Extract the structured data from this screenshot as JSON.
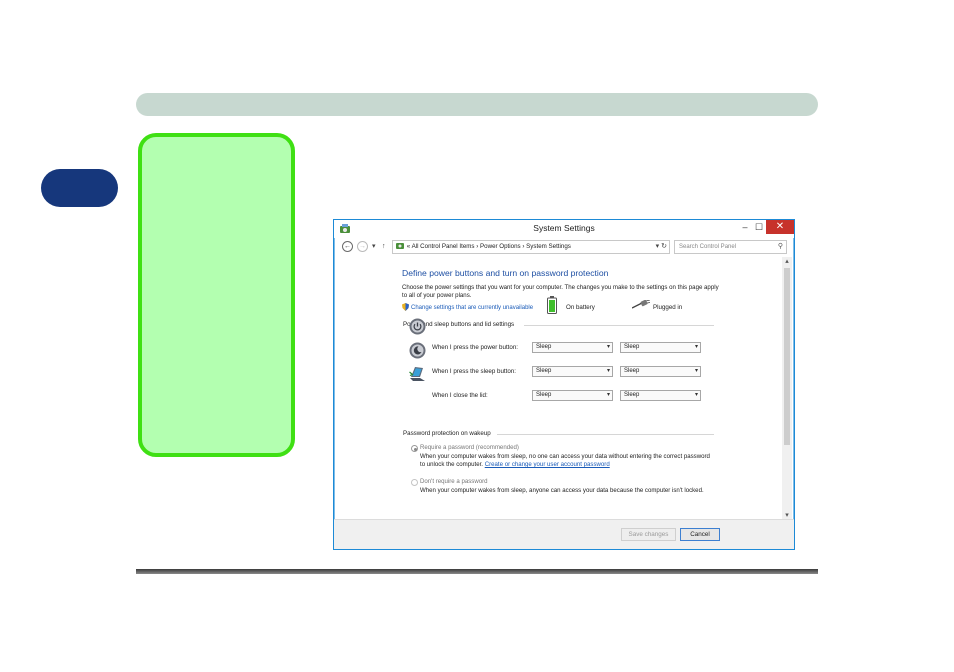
{
  "window": {
    "title": "System Settings",
    "controls": {
      "minimize": "–",
      "maximize": "☐",
      "close": "✕"
    }
  },
  "address_bar": {
    "prefix": "«",
    "breadcrumbs": [
      "All Control Panel Items",
      "Power Options",
      "System Settings"
    ],
    "separator": "›",
    "search_placeholder": "Search Control Panel"
  },
  "page": {
    "heading": "Define power buttons and turn on password protection",
    "description": "Choose the power settings that you want for your computer. The changes you make to the settings on this page apply to all of your power plans.",
    "change_link": "Change settings that are currently unavailable"
  },
  "power_section": {
    "label": "Power and sleep buttons and lid settings",
    "columns": {
      "battery": "On battery",
      "plugged": "Plugged in"
    },
    "rows": [
      {
        "label": "When I press the power button:",
        "battery": "Sleep",
        "plugged": "Sleep",
        "icon": "power-button-icon"
      },
      {
        "label": "When I press the sleep button:",
        "battery": "Sleep",
        "plugged": "Sleep",
        "icon": "sleep-button-icon"
      },
      {
        "label": "When I close the lid:",
        "battery": "Sleep",
        "plugged": "Sleep",
        "icon": "laptop-lid-icon"
      }
    ]
  },
  "password_section": {
    "label": "Password protection on wakeup",
    "options": [
      {
        "label": "Require a password (recommended)",
        "selected": true,
        "desc_before": "When your computer wakes from sleep, no one can access your data without entering the correct password to unlock the computer.",
        "desc_link": "Create or change your user account password"
      },
      {
        "label": "Don't require a password",
        "selected": false,
        "desc_before": "When your computer wakes from sleep, anyone can access your data because the computer isn't locked.",
        "desc_link": ""
      }
    ]
  },
  "footer": {
    "save": "Save changes",
    "cancel": "Cancel"
  },
  "colors": {
    "accent": "#1d8ad6",
    "heading": "#1e4fa3",
    "link": "#1a5bb8",
    "green_fill": "#b3ffb0",
    "green_border": "#3fe013",
    "tab": "#16377c"
  }
}
